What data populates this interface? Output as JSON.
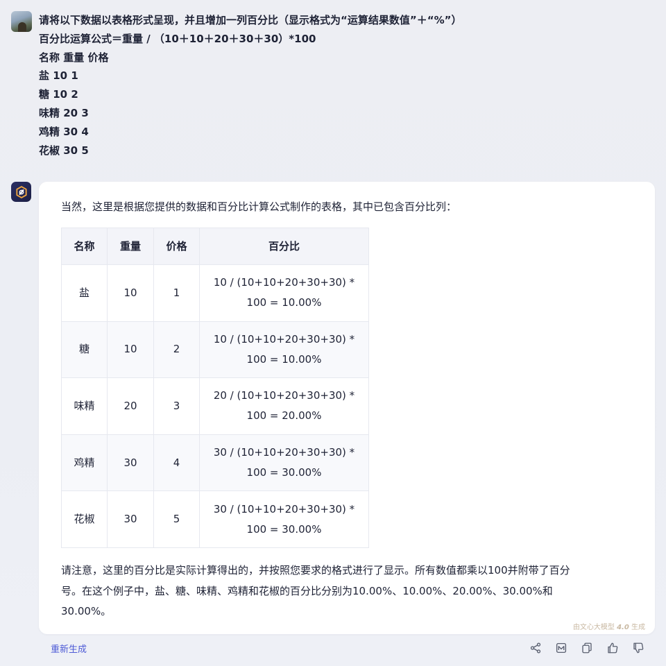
{
  "user": {
    "avatar_icon": "user-avatar-photo",
    "lines": [
      "请将以下数据以表格形式呈现，并且增加一列百分比（显示格式为“运算结果数值”＋“%”）",
      "百分比运算公式＝重量 / （10＋10＋20＋30＋30）*100",
      "名称 重量 价格",
      "盐 10 1",
      "糖 10 2",
      "味精 20 3",
      "鸡精 30 4",
      "花椒 30 5"
    ]
  },
  "bot": {
    "avatar_icon": "ernie-bot-logo",
    "intro": "当然，这里是根据您提供的数据和百分比计算公式制作的表格，其中已包含百分比列：",
    "table": {
      "headers": [
        "名称",
        "重量",
        "价格",
        "百分比"
      ],
      "rows": [
        {
          "name": "盐",
          "weight": "10",
          "price": "1",
          "pct_line1": "10 / (10+10+20+30+30) *",
          "pct_line2": "100 = 10.00%"
        },
        {
          "name": "糖",
          "weight": "10",
          "price": "2",
          "pct_line1": "10 / (10+10+20+30+30) *",
          "pct_line2": "100 = 10.00%"
        },
        {
          "name": "味精",
          "weight": "20",
          "price": "3",
          "pct_line1": "20 / (10+10+20+30+30) *",
          "pct_line2": "100 = 20.00%"
        },
        {
          "name": "鸡精",
          "weight": "30",
          "price": "4",
          "pct_line1": "30 / (10+10+20+30+30) *",
          "pct_line2": "100 = 30.00%"
        },
        {
          "name": "花椒",
          "weight": "30",
          "price": "5",
          "pct_line1": "30 / (10+10+20+30+30) *",
          "pct_line2": "100 = 30.00%"
        }
      ]
    },
    "footer_lines": [
      "请注意，这里的百分比是实际计算得出的，并按照您要求的格式进行了显示。所有数值都乘以100并附带了百分",
      "号。在这个例子中，盐、糖、味精、鸡精和花椒的百分比分别为10.00%、10.00%、20.00%、30.00%和",
      "30.00%。"
    ],
    "watermark_prefix": "由文心大模型",
    "watermark_version": "4.0",
    "watermark_suffix": "生成"
  },
  "actions": {
    "regenerate_label": "重新生成",
    "icons": [
      "share-icon",
      "image-icon",
      "copy-icon",
      "thumbs-up-icon",
      "thumbs-down-icon"
    ]
  },
  "colors": {
    "accent": "#4e5bd6",
    "text": "#1e2235",
    "header_bg": "#f3f4f9",
    "border": "#e6e8ef"
  }
}
